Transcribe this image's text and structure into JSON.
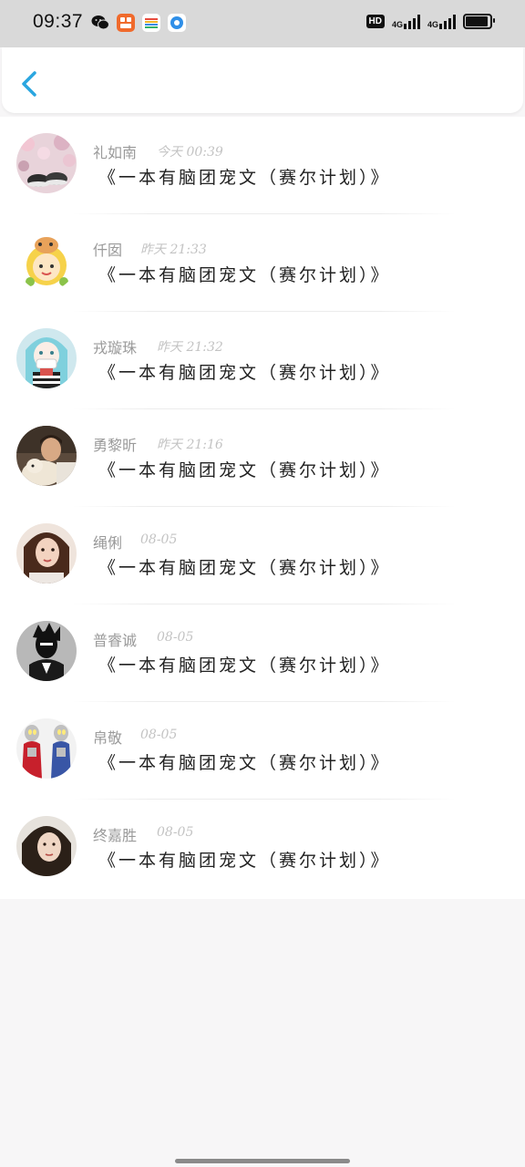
{
  "status_bar": {
    "time": "09:37",
    "apps": [
      {
        "name": "wechat-icon",
        "color": "#111111",
        "glyph": "●"
      },
      {
        "name": "app-orange-icon",
        "color": "#f06a2c",
        "glyph": "◉"
      },
      {
        "name": "app-stripes-icon",
        "color": "#ffffff",
        "glyph": "≡"
      },
      {
        "name": "app-blue-icon",
        "color": "#ffffff",
        "glyph": "◎"
      }
    ],
    "hd_label": "HD",
    "network_label_1": "4G",
    "network_label_2": "4G"
  },
  "header": {
    "back_icon": "chevron-left-icon",
    "accent_color": "#2aa6e0"
  },
  "comments": [
    {
      "name": "礼如南",
      "time": "今天 00:39",
      "text": "《一本有脑团宠文（赛尔计划）》",
      "avatar": "flowers-shoes"
    },
    {
      "name": "仟囡",
      "time": "昨天 21:33",
      "text": "《一本有脑团宠文（赛尔计划）》",
      "avatar": "cartoon-girl"
    },
    {
      "name": "戎璇珠",
      "time": "昨天 21:32",
      "text": "《一本有脑团宠文（赛尔计划）》",
      "avatar": "anime-blue-hair"
    },
    {
      "name": "勇黎昕",
      "time": "昨天 21:16",
      "text": "《一本有脑团宠文（赛尔计划）》",
      "avatar": "man-with-dog"
    },
    {
      "name": "绳俐",
      "time": "08-05",
      "text": "《一本有脑团宠文（赛尔计划）》",
      "avatar": "woman-portrait"
    },
    {
      "name": "普睿诚",
      "time": "08-05",
      "text": "《一本有脑团宠文（赛尔计划）》",
      "avatar": "manga-man"
    },
    {
      "name": "帛敬",
      "time": "08-05",
      "text": "《一本有脑团宠文（赛尔计划）》",
      "avatar": "ultraman"
    },
    {
      "name": "终嘉胜",
      "time": "08-05",
      "text": "《一本有脑团宠文（赛尔计划）》",
      "avatar": "girl-dark-hair"
    }
  ]
}
